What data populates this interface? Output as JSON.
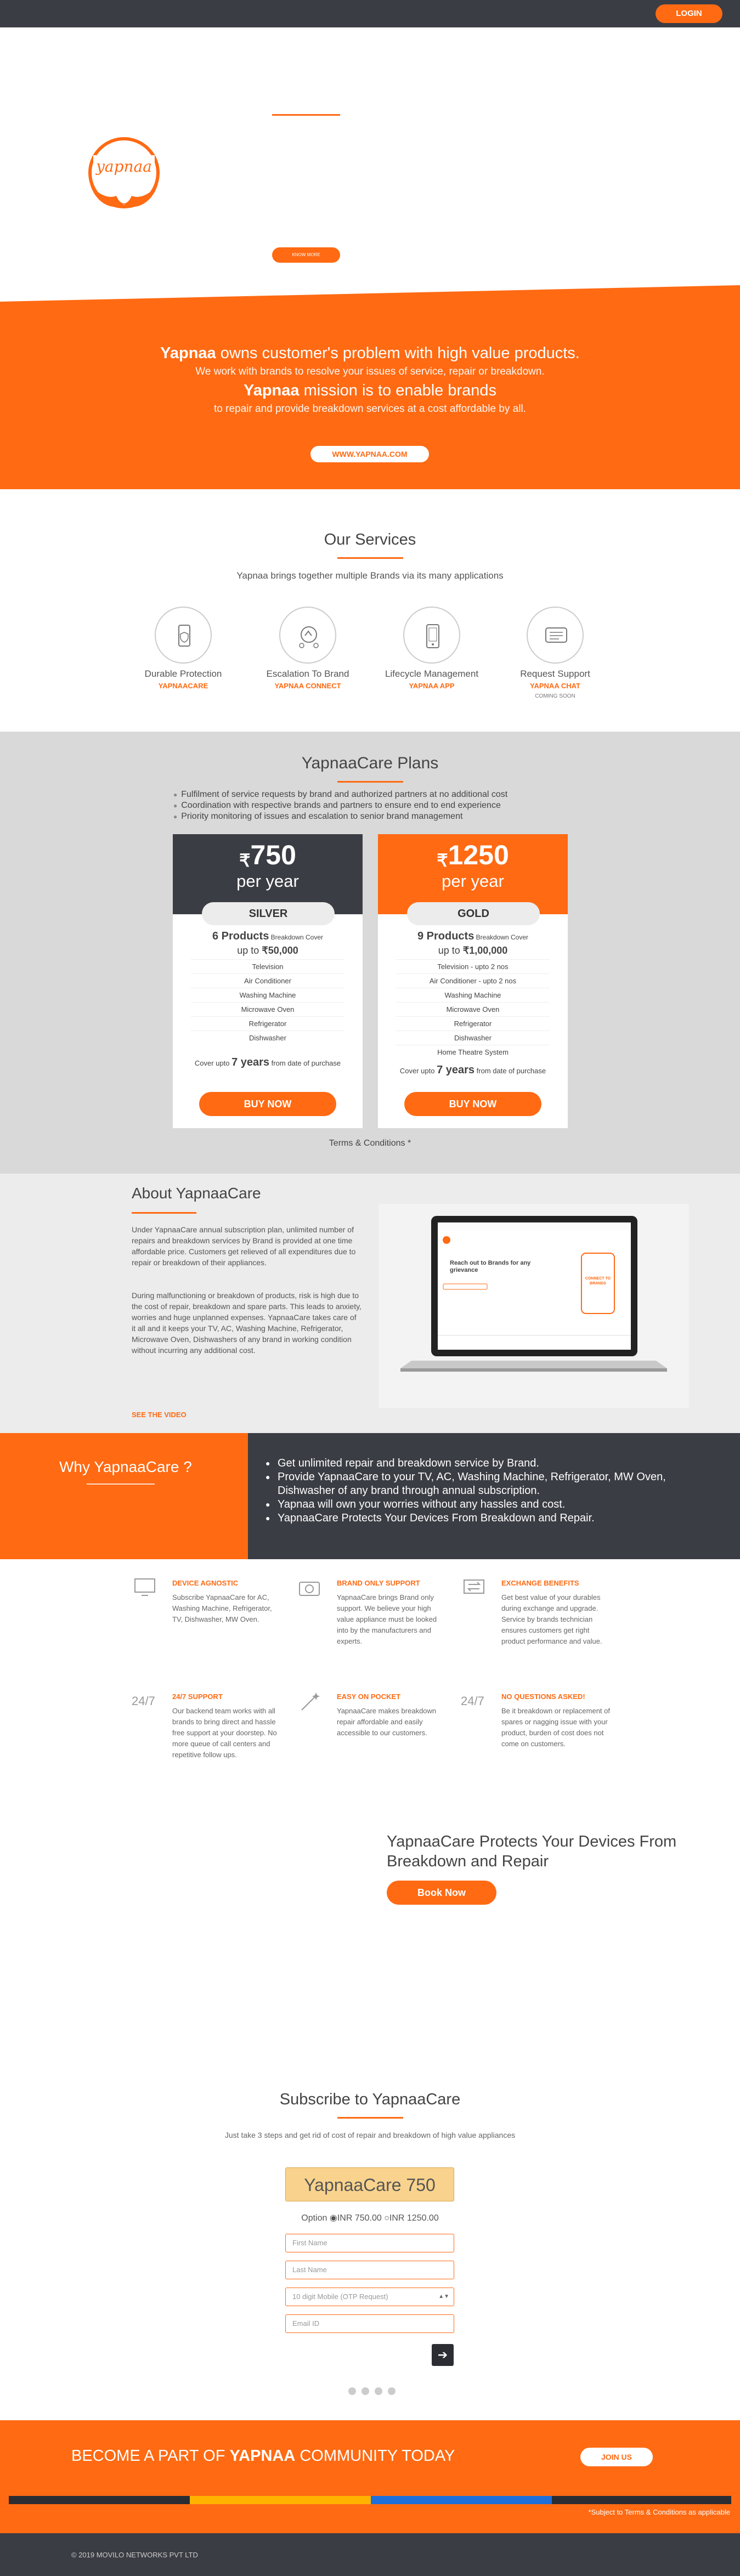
{
  "header": {
    "login_label": "LOGIN"
  },
  "hero": {
    "logo_text": "yapnaa",
    "learn_more_label": "KNOW MORE"
  },
  "mission": {
    "line1_brand": "Yapnaa",
    "line1_rest": " owns customer's problem with high value products.",
    "line2": "We work with brands to resolve your issues of service, repair or breakdown.",
    "line3_brand": "Yapnaa",
    "line3_rest": " mission is to enable brands",
    "line4": "to repair and provide breakdown services at a cost affordable by all.",
    "url_label": "WWW.YAPNAA.COM"
  },
  "services": {
    "title": "Our Services",
    "subtitle": "Yapnaa brings together multiple Brands via its many applications",
    "items": [
      {
        "name": "Durable Protection",
        "tag": "YAPNAACARE",
        "note": "",
        "icon": "phone-shield-icon"
      },
      {
        "name": "Escalation To Brand",
        "tag": "YAPNAA CONNECT",
        "note": "",
        "icon": "escalation-icon"
      },
      {
        "name": "Lifecycle Management",
        "tag": "YAPNAA APP",
        "note": "",
        "icon": "mobile-app-icon"
      },
      {
        "name": "Request Support",
        "tag": "YAPNAA CHAT",
        "note": "COMING SOON",
        "icon": "chat-icon"
      }
    ]
  },
  "plans": {
    "title": "YapnaaCare Plans",
    "bullets": [
      "Fulfilment of service requests by brand and authorized partners at no additional cost",
      "Coordination with respective brands and partners to ensure end to end experience",
      "Priority monitoring of issues and escalation to senior brand management"
    ],
    "currency_symbol": "₹",
    "cards": [
      {
        "price": "750",
        "per": "per year",
        "badge": "SILVER",
        "products": "6 Products",
        "products_small": " Breakdown Cover",
        "upto_prefix": "up to ",
        "upto_value": "₹50,000",
        "items": [
          "Television",
          "Air Conditioner",
          "Washing Machine",
          "Microwave Oven",
          "Refrigerator",
          "Dishwasher"
        ],
        "cover_prefix": "Cover upto ",
        "cover_years": "7 years",
        "cover_suffix": " from date of purchase",
        "buy_label": "BUY NOW",
        "header_color": "#3b3d44"
      },
      {
        "price": "1250",
        "per": "per year",
        "badge": "GOLD",
        "products": "9 Products",
        "products_small": " Breakdown Cover",
        "upto_prefix": "up to ",
        "upto_value": "₹1,00,000",
        "items": [
          "Television - upto 2 nos",
          "Air Conditioner - upto 2 nos",
          "Washing Machine",
          "Microwave Oven",
          "Refrigerator",
          "Dishwasher",
          "Home Theatre System"
        ],
        "cover_prefix": "Cover upto ",
        "cover_years": "7 years",
        "cover_suffix": " from date of purchase",
        "buy_label": "BUY NOW",
        "header_color": "#ff6a13"
      }
    ],
    "terms_label": "Terms & Conditions *"
  },
  "about": {
    "title": "About YapnaaCare",
    "para1": "Under YapnaaCare annual subscription plan, unlimited number of repairs and breakdown services by Brand is provided at one time affordable price. Customers get relieved of all expenditures due to repair or breakdown of their appliances.",
    "para2": "During malfunctioning or breakdown of products, risk is high due to the cost of repair, breakdown and spare parts. This leads to anxiety, worries and huge unplanned expenses. YapnaaCare takes care of it all and it keeps your TV, AC, Washing Machine, Refrigerator, Microwave Oven, Dishwashers of any brand in working condition without incurring any additional cost.",
    "video_label": "SEE THE VIDEO",
    "laptop_screen_heading": "Reach out to Brands for any grievance",
    "laptop_screen_phone": "CONNECT TO BRANDS"
  },
  "why": {
    "title": "Why YapnaaCare ?",
    "points": [
      "Get unlimited repair and breakdown service by Brand.",
      "Provide YapnaaCare to your TV, AC, Washing Machine, Refrigerator, MW Oven, Dishwasher of any brand through annual subscription.",
      "Yapnaa will own your worries without any hassles and cost.",
      "YapnaaCare Protects Your Devices From Breakdown and Repair."
    ]
  },
  "features": [
    {
      "title": "DEVICE AGNOSTIC",
      "desc": "Subscribe YapnaaCare for AC, Washing Machine, Refrigerator, TV, Dishwasher, MW Oven.",
      "icon": "monitor-icon",
      "glyph": ""
    },
    {
      "title": "BRAND ONLY SUPPORT",
      "desc": "YapnaaCare brings Brand only support. We believe your high value appliance must be looked into by the manufacturers and experts.",
      "icon": "camera-icon",
      "glyph": ""
    },
    {
      "title": "EXCHANGE BENEFITS",
      "desc": "Get best value of your durables during exchange and upgrade. Service by brands technician ensures customers get right product performance and value.",
      "icon": "exchange-icon",
      "glyph": ""
    },
    {
      "title": "24/7 SUPPORT",
      "desc": "Our backend team works with all brands to bring direct and hassle free support at your doorstep. No more queue of call centers and repetitive follow ups.",
      "icon": "clock-24-7-icon",
      "glyph": "24/7"
    },
    {
      "title": "EASY ON POCKET",
      "desc": "YapnaaCare makes breakdown repair affordable and easily accessible to our customers.",
      "icon": "magic-wand-icon",
      "glyph": ""
    },
    {
      "title": "NO QUESTIONS ASKED!",
      "desc": "Be it breakdown or replacement of spares or nagging issue with your product, burden of cost does not come on customers.",
      "icon": "no-questions-icon",
      "glyph": "24/7"
    }
  ],
  "protect": {
    "title": "YapnaaCare Protects Your Devices From Breakdown and Repair",
    "book_label": "Book Now"
  },
  "subscribe": {
    "title": "Subscribe to YapnaaCare",
    "desc": "Just take 3 steps and get rid of cost of repair and breakdown of high value appliances",
    "plan_box": "YapnaaCare 750",
    "option_label": "Option",
    "option_a": "INR 750.00",
    "option_b": "INR 1250.00",
    "first_name_placeholder": "First Name",
    "last_name_placeholder": "Last Name",
    "mobile_placeholder": "10 digit Mobile (OTP Request)",
    "email_placeholder": "Email ID",
    "submit_glyph": "➔"
  },
  "community": {
    "title_pre": "BECOME A PART OF ",
    "title_brand": "YAPNAA",
    "title_post": " COMMUNITY TODAY",
    "join_label": "JOIN US",
    "subject_note": "*Subject to Terms & Conditions as applicable"
  },
  "footer": {
    "copyright": "© 2019 MOVILO NETWORKS PVT LTD"
  },
  "colors": {
    "accent": "#ff6a13",
    "dark": "#3b3d44",
    "gray_bg": "#d9d9d9"
  }
}
